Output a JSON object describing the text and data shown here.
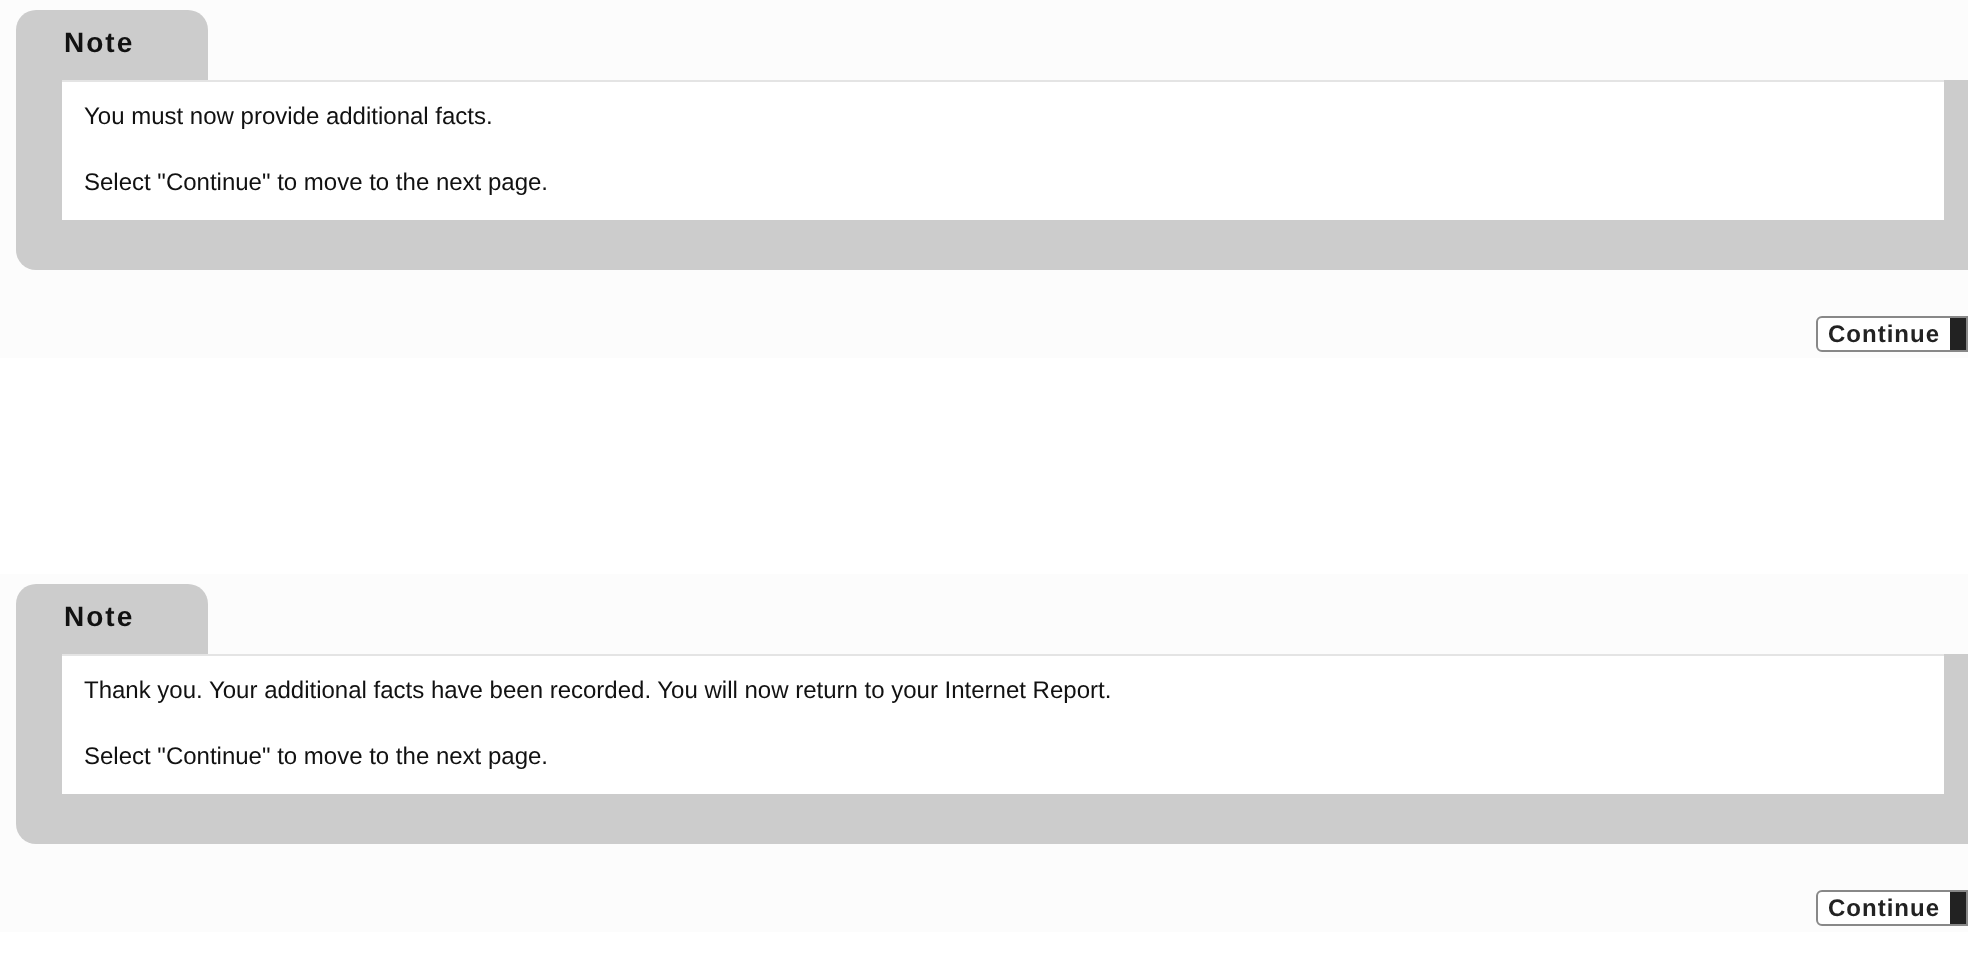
{
  "notes": [
    {
      "title": "Note",
      "lines": [
        "You must now provide additional facts.",
        "Select \"Continue\" to move to the next page."
      ],
      "button": "Continue"
    },
    {
      "title": "Note",
      "lines": [
        "Thank you. Your additional facts have been recorded. You will now return to your Internet Report.",
        "Select \"Continue\" to move to the next page."
      ],
      "button": "Continue"
    }
  ]
}
